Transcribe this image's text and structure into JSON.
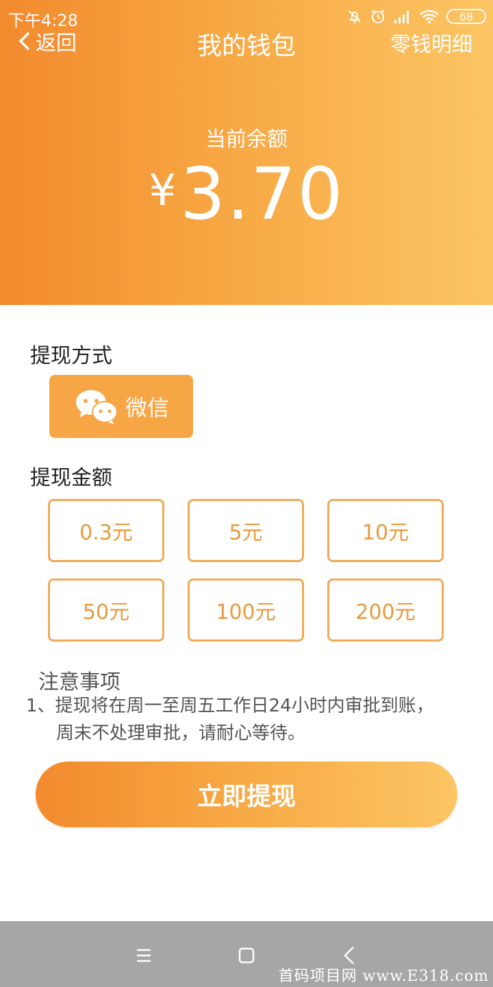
{
  "status_bar": {
    "time": "下午4:28",
    "battery": "68",
    "icons": [
      "bell-off-icon",
      "alarm-icon",
      "signal-icon",
      "wifi-icon",
      "battery-icon"
    ]
  },
  "header": {
    "back_label": "返回",
    "title": "我的钱包",
    "detail_link": "零钱明细"
  },
  "balance": {
    "label": "当前余额",
    "currency": "¥",
    "amount": "3.70"
  },
  "withdraw_method": {
    "title": "提现方式",
    "option": "微信",
    "option_icon": "wechat-icon"
  },
  "withdraw_amount": {
    "title": "提现金额",
    "options": [
      "0.3元",
      "5元",
      "10元",
      "50元",
      "100元",
      "200元"
    ]
  },
  "notes": {
    "title": "注意事项",
    "line1": "1、提现将在周一至周五工作日24小时内审批到账，",
    "line2": "周末不处理审批，请耐心等待。"
  },
  "submit_label": "立即提现",
  "watermark": "首码项目网 www.E318.com",
  "colors": {
    "gradient_start": "#f28a2e",
    "gradient_end": "#fcc563",
    "accent": "#f7a646",
    "amount_border": "#f0aa55"
  }
}
